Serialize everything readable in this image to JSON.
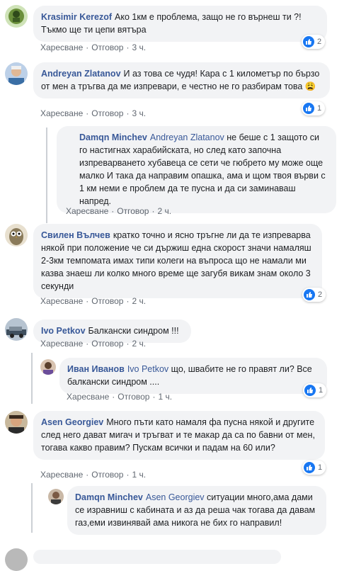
{
  "actions": {
    "like": "Харесване",
    "reply": "Отговор"
  },
  "comments": [
    {
      "author": "Krasimir Kerezof",
      "text": "Ако 1км е проблема, защо не го върнеш ти ?! Тъкмо ще ти цепи вятъра",
      "time": "3 ч.",
      "reactions": "2"
    },
    {
      "author": "Andreyan Zlatanov",
      "text": "И аз това се чудя! Кара с 1 километър по бързо от мен а тръгва да ме изпревари, е честно не го разбирам това",
      "emoji": "😩",
      "time": "3 ч.",
      "reactions": "1"
    },
    {
      "author": "Damqn Minchev",
      "mention": "Andreyan Zlatanov",
      "text": "не беше с 1 защото си го настигнах харабийската, но след като започна изпреварването хубавеца се сети че гюбрето му може още малко И така да направим опашка, ама и щом твоя върви с 1 км неми е проблем да те пусна и да си заминаваш напред.",
      "time": "2 ч."
    },
    {
      "author": "Свилен Вълчев",
      "text": "кратко точно и ясно тръгне ли да те изпреварва някой при положение че си държиш една скорост значи намаляш 2-3км темпомата имах типи колеги на въпроса що не намали ми казва знаеш ли колко много време ще загубя викам знам около 3 секунди",
      "time": "2 ч.",
      "reactions": "2"
    },
    {
      "author": "Ivo Petkov",
      "text": "Балкански синдром !!!",
      "time": "2 ч."
    },
    {
      "author": "Иван Иванов",
      "mention": "Ivo Petkov",
      "text": "що, швабите не го правят ли? Все балкански синдром ....",
      "time": "1 ч.",
      "reactions": "1"
    },
    {
      "author": "Asen Georgiev",
      "text": "Много пъти като намаля фа пусна някой и другите след него дават мигач и тръгват и те макар да са по бавни от мен, тогава какво правим? Пускам всички и падам на 60 или?",
      "time": "1 ч.",
      "reactions": "1"
    },
    {
      "author": "Damqn Minchev",
      "mention": "Asen Georgiev",
      "text": "ситуации много,ама дами се изравниш с кабината и аз да реша чак тогава да давам газ,еми извинявай ама никога не бих го направил!",
      "time": ""
    }
  ]
}
